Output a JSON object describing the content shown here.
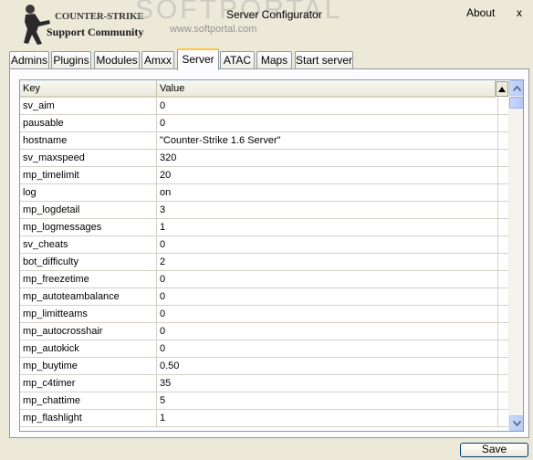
{
  "header": {
    "logo_title": "COUNTER-STRIKE",
    "logo_subtitle": "Support Community",
    "watermark": "SOFTPORTAL",
    "watermark_url": "www.softportal.com",
    "app_title": "Server Configurator",
    "about_label": "About",
    "close_label": "x"
  },
  "tabs": [
    {
      "label": "Admins"
    },
    {
      "label": "Plugins"
    },
    {
      "label": "Modules"
    },
    {
      "label": "Amxx"
    },
    {
      "label": "Server",
      "active": true
    },
    {
      "label": "ATAC"
    },
    {
      "label": "Maps"
    },
    {
      "label": "Start server"
    }
  ],
  "grid": {
    "columns": [
      "Key",
      "Value"
    ],
    "rows": [
      [
        "sv_aim",
        "0"
      ],
      [
        "pausable",
        "0"
      ],
      [
        "hostname",
        "\"Counter-Strike 1.6 Server\""
      ],
      [
        "sv_maxspeed",
        "320"
      ],
      [
        "mp_timelimit",
        "20"
      ],
      [
        "log",
        "on"
      ],
      [
        "mp_logdetail",
        "3"
      ],
      [
        "mp_logmessages",
        "1"
      ],
      [
        "sv_cheats",
        "0"
      ],
      [
        "bot_difficulty",
        "2"
      ],
      [
        "mp_freezetime",
        "0"
      ],
      [
        "mp_autoteambalance",
        "0"
      ],
      [
        "mp_limitteams",
        "0"
      ],
      [
        "mp_autocrosshair",
        "0"
      ],
      [
        "mp_autokick",
        "0"
      ],
      [
        "mp_buytime",
        "0.50"
      ],
      [
        "mp_c4timer",
        "35"
      ],
      [
        "mp_chattime",
        "5"
      ],
      [
        "mp_flashlight",
        "1"
      ]
    ]
  },
  "footer": {
    "save_label": "Save"
  },
  "colors": {
    "window_bg": "#ece9d8",
    "active_tab_accent": "#ffc83c",
    "scrollbar": "#c1d3fb"
  }
}
